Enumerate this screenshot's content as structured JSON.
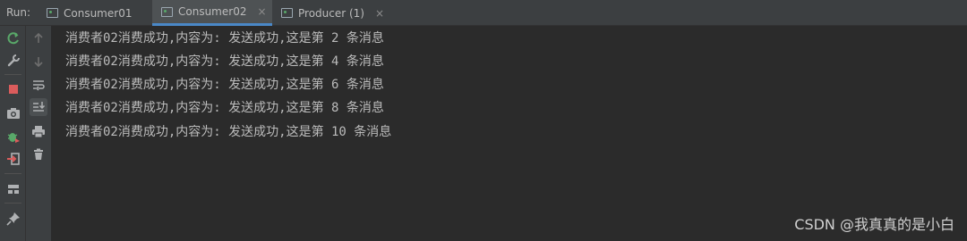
{
  "run_bar": {
    "label": "Run:",
    "tabs": [
      {
        "label": "Consumer01",
        "active": false
      },
      {
        "label": "Consumer02",
        "active": true
      },
      {
        "label": "Producer (1)",
        "active": false
      }
    ],
    "close_glyph": "×"
  },
  "toolbar_left": [
    {
      "icon": "rerun-icon"
    },
    {
      "icon": "wrench-icon"
    },
    {
      "icon": "stop-icon"
    },
    {
      "icon": "camera-icon"
    },
    {
      "icon": "debug-bug-icon"
    },
    {
      "icon": "exit-icon"
    },
    {
      "icon": "layout-icon"
    },
    {
      "icon": "pin-icon"
    }
  ],
  "toolbar_right": [
    {
      "icon": "arrow-up-icon"
    },
    {
      "icon": "arrow-down-icon"
    },
    {
      "icon": "soft-wrap-icon"
    },
    {
      "icon": "scroll-to-end-icon"
    },
    {
      "icon": "print-icon"
    },
    {
      "icon": "trash-icon"
    }
  ],
  "console": {
    "lines": [
      "消费者02消费成功,内容为: 发送成功,这是第 2 条消息",
      "消费者02消费成功,内容为: 发送成功,这是第 4 条消息",
      "消费者02消费成功,内容为: 发送成功,这是第 6 条消息",
      "消费者02消费成功,内容为: 发送成功,这是第 8 条消息",
      "消费者02消费成功,内容为: 发送成功,这是第 10 条消息"
    ]
  },
  "watermark": "CSDN @我真真的是小白",
  "colors": {
    "accent": "#4a88c7",
    "rerun": "#59a869",
    "stop": "#db5c5c",
    "text": "#bbbbbb"
  }
}
